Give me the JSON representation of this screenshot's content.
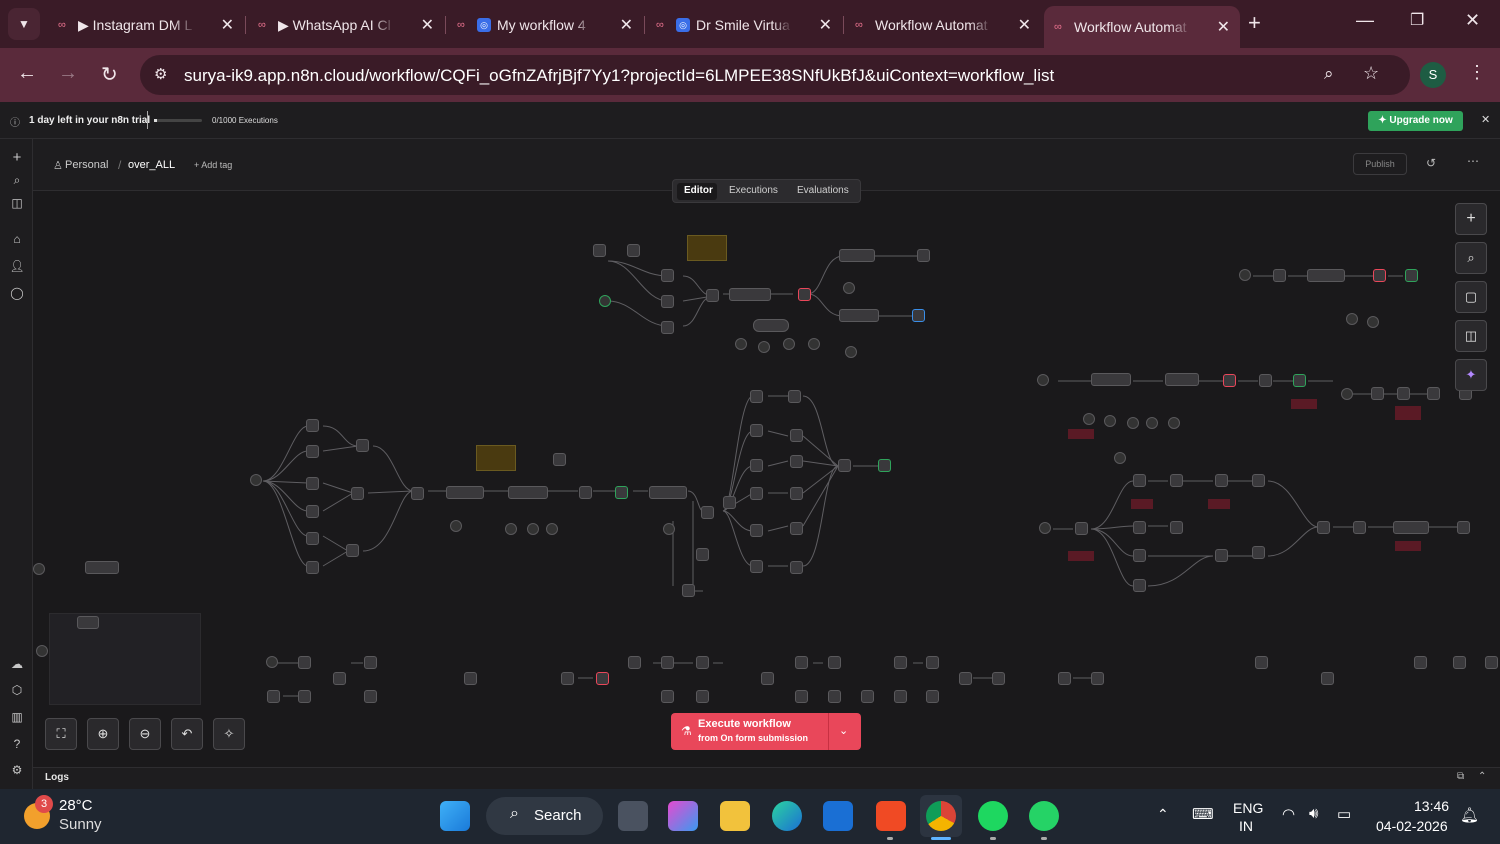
{
  "browser": {
    "tabs": [
      {
        "title": "▶ Instagram DM L",
        "icon": "n8n-icon"
      },
      {
        "title": "▶ WhatsApp AI Cl",
        "icon": "n8n-icon"
      },
      {
        "title": "My workflow 4",
        "icon": "n8n-icon"
      },
      {
        "title": "Dr Smile Virtua",
        "icon": "n8n-icon"
      },
      {
        "title": "Workflow Automat",
        "icon": "n8n-icon"
      },
      {
        "title": "Workflow Automat",
        "icon": "n8n-icon"
      }
    ],
    "active_tab": 5,
    "url": "surya-ik9.app.n8n.cloud/workflow/CQFi_oGfnZAfrjBjf7Yy1?projectId=6LMPEE38SNfUkBfJ&uiContext=workflow_list",
    "profile_initial": "S",
    "accent": "#5a2a3b"
  },
  "trial": {
    "text": "1 day left in your n8n trial",
    "executions": "0/1000 Executions",
    "upgrade_label": "Upgrade now",
    "upgrade_color": "#2fa35b"
  },
  "header": {
    "project": "Personal",
    "workflow_name": "over_ALL",
    "add_tag": "+ Add tag",
    "publish": "Publish"
  },
  "editor_tabs": [
    "Editor",
    "Executions",
    "Evaluations"
  ],
  "active_editor_tab": "Editor",
  "execute": {
    "label": "Execute workflow",
    "sublabel": "from On form submission",
    "color": "#e9475a"
  },
  "logs_label": "Logs",
  "taskbar": {
    "weather_temp": "28°C",
    "weather_desc": "Sunny",
    "weather_badge": "3",
    "search": "Search",
    "lang_top": "ENG",
    "lang_bottom": "IN",
    "time": "13:46",
    "date": "04-02-2026"
  }
}
